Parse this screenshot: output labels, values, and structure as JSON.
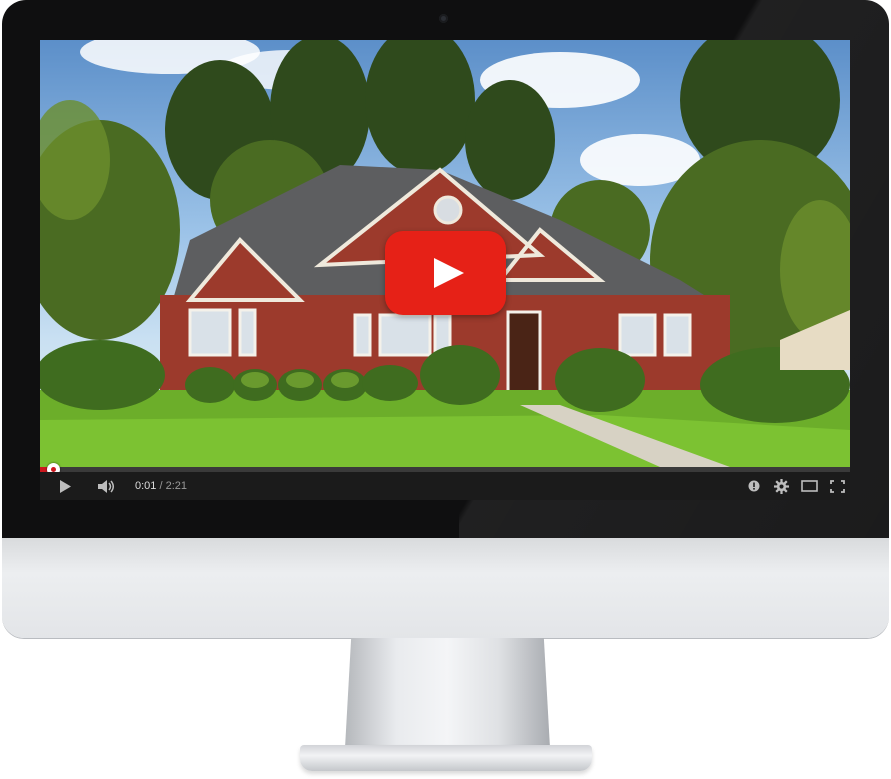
{
  "player": {
    "current_time": "0:01",
    "separator": " / ",
    "duration": "2:21",
    "progress_fraction": 0.012,
    "accent_color": "#cc181e",
    "play_button_color": "#e62117"
  },
  "controls": {
    "play": "play-icon",
    "volume": "volume-icon",
    "annotations": "info-icon",
    "settings": "gear-icon",
    "theater": "theater-mode-icon",
    "fullscreen": "fullscreen-icon"
  }
}
